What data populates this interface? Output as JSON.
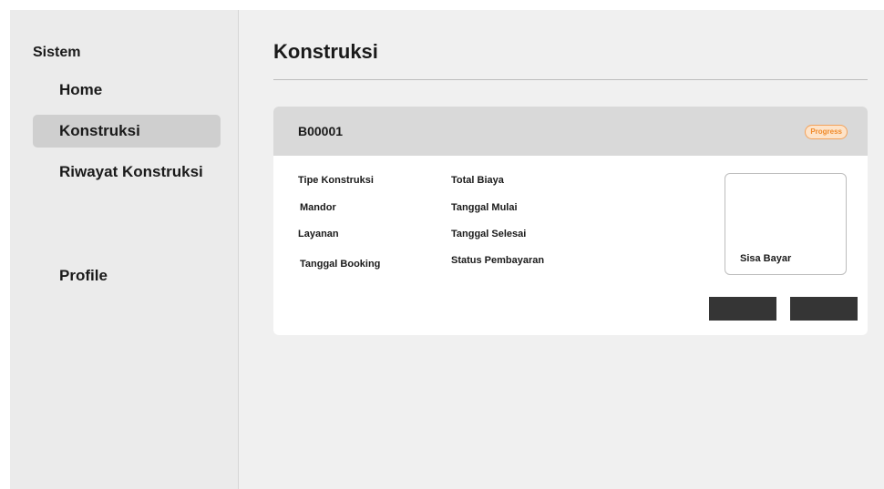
{
  "sidebar": {
    "brand": "Sistem",
    "items": [
      {
        "label": "Home"
      },
      {
        "label": "Konstruksi"
      },
      {
        "label": "Riwayat Konstruksi"
      },
      {
        "label": "Profile"
      }
    ]
  },
  "main": {
    "title": "Konstruksi"
  },
  "card": {
    "code": "B00001",
    "status": "Progress",
    "fields": {
      "tipe_konstruksi": "Tipe Konstruksi",
      "mandor": "Mandor",
      "layanan": "Layanan",
      "tanggal_booking": "Tanggal Booking",
      "total_biaya": "Total Biaya",
      "tanggal_mulai": "Tanggal Mulai",
      "tanggal_selesai": "Tanggal Selesai",
      "status_pembayaran": "Status Pembayaran"
    },
    "sisa_bayar": "Sisa Bayar"
  },
  "colors": {
    "status_badge_text": "#f08a2a",
    "status_badge_bg": "#fde3c9",
    "button_bg": "#353535",
    "active_nav_bg": "#cfcfcf"
  }
}
